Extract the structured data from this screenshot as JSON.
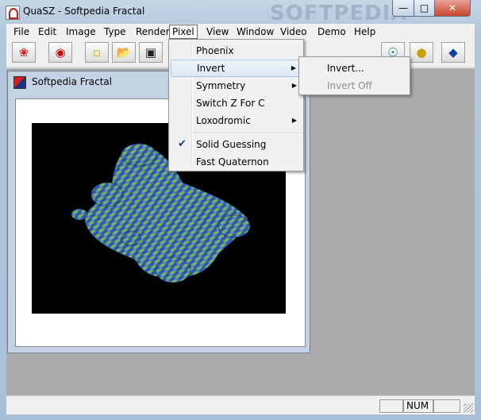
{
  "window": {
    "title": "QuaSZ - Softpedia Fractal",
    "watermark": "SOFTPEDIA"
  },
  "menubar": [
    "File",
    "Edit",
    "Image",
    "Type",
    "Render",
    "Pixel",
    "View",
    "Window",
    "Video",
    "Demo",
    "Help"
  ],
  "toolbar": {
    "icons": [
      "fractal-icon",
      "ladybug-icon",
      "new-image-icon",
      "open-folder-icon",
      "save-disk-icon",
      "page-icon",
      "copy-page-icon",
      "zoom-icon",
      "render-icon",
      "diamond-icon"
    ]
  },
  "child_window": {
    "title": "Softpedia Fractal"
  },
  "pixel_menu": {
    "items": [
      {
        "label": "Phoenix"
      },
      {
        "label": "Invert",
        "submenu": true
      },
      {
        "label": "Symmetry",
        "submenu": true
      },
      {
        "label": "Switch Z For C"
      },
      {
        "label": "Loxodromic",
        "submenu": true
      },
      {
        "label": "Solid Guessing",
        "checked": true
      },
      {
        "label": "Fast Quaternon"
      }
    ]
  },
  "invert_submenu": {
    "items": [
      {
        "label": "Invert..."
      },
      {
        "label": "Invert Off",
        "disabled": true
      }
    ]
  },
  "statusbar": {
    "num": "NUM"
  },
  "colors": {
    "workspace": "#ababab",
    "menu_highlight": "#dce8f5",
    "canvas": "#000000"
  }
}
